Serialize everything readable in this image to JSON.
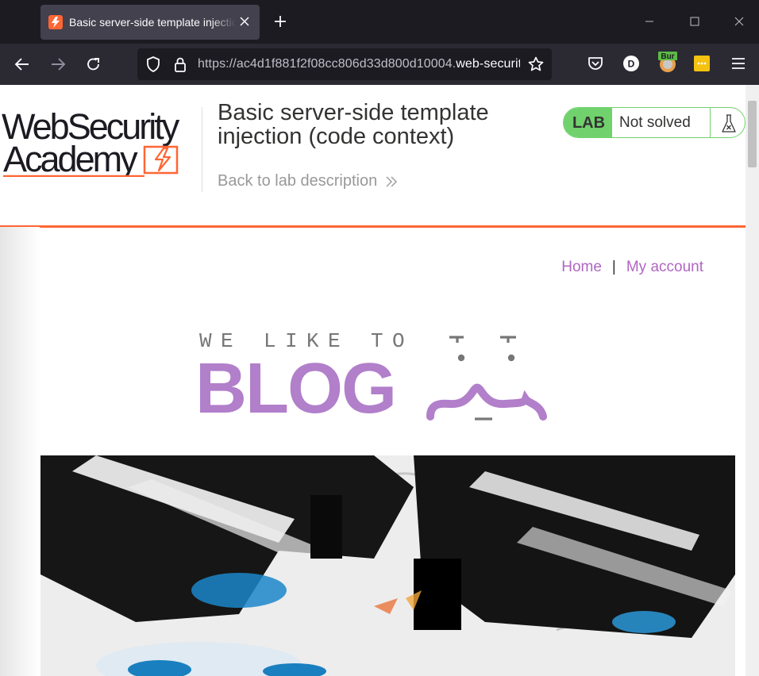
{
  "browser": {
    "tab_title": "Basic server-side template injection (code context)",
    "url_prefix": "https://",
    "url_subdomain": "ac4d1f881f2f08cc806d33d800d10004.",
    "url_host": "web-security-academy.net",
    "window_controls": [
      "minimize",
      "maximize",
      "close"
    ],
    "extensions": [
      {
        "name": "pocket-icon"
      },
      {
        "name": "profile-avatar",
        "letter": "D"
      },
      {
        "name": "burp-extension-icon",
        "label": "Bur"
      },
      {
        "name": "yellow-extension-icon"
      },
      {
        "name": "menu-icon"
      }
    ]
  },
  "academy": {
    "logo_line1": "WebSecurity",
    "logo_line2": "Academy",
    "lab_title": "Basic server-side template injection (code context)",
    "back_link": "Back to lab description",
    "lab_badge": "LAB",
    "lab_status": "Not solved"
  },
  "site_nav": {
    "home": "Home",
    "separator": "|",
    "my_account": "My account"
  },
  "banner": {
    "tagline": "WE LIKE TO",
    "word": "BLOG"
  },
  "colors": {
    "accent_orange": "#ff6633",
    "lab_green": "#70d16d",
    "link_purple": "#b066c2",
    "blog_purple": "#b27fcb",
    "browser_dark": "#1c1b22"
  }
}
